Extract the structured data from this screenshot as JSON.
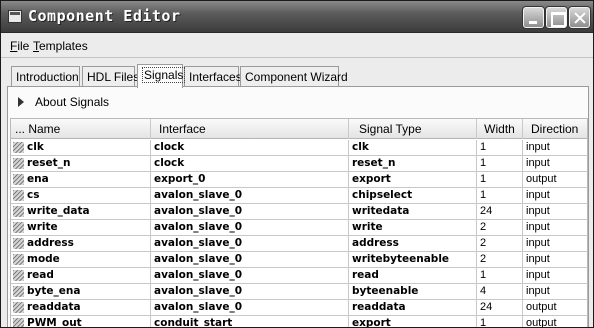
{
  "window": {
    "title": "Component Editor"
  },
  "menu": {
    "file": {
      "mnemonic": "F",
      "rest": "ile"
    },
    "templates": {
      "mnemonic": "T",
      "rest": "emplates"
    }
  },
  "tabs": [
    {
      "label": "Introduction",
      "active": false
    },
    {
      "label": "HDL Files",
      "active": false
    },
    {
      "label": "Signals",
      "active": true
    },
    {
      "label": "Interfaces",
      "active": false
    },
    {
      "label": "Component Wizard",
      "active": false
    }
  ],
  "about_section": {
    "label": "About Signals"
  },
  "table": {
    "columns": [
      "Name",
      "Interface",
      "Signal Type",
      "Width",
      "Direction"
    ],
    "rows": [
      {
        "name": "clk",
        "interface": "clock",
        "signal_type": "clk",
        "width": "1",
        "direction": "input"
      },
      {
        "name": "reset_n",
        "interface": "clock",
        "signal_type": "reset_n",
        "width": "1",
        "direction": "input"
      },
      {
        "name": "ena",
        "interface": "export_0",
        "signal_type": "export",
        "width": "1",
        "direction": "output"
      },
      {
        "name": "cs",
        "interface": "avalon_slave_0",
        "signal_type": "chipselect",
        "width": "1",
        "direction": "input"
      },
      {
        "name": "write_data",
        "interface": "avalon_slave_0",
        "signal_type": "writedata",
        "width": "24",
        "direction": "input"
      },
      {
        "name": "write",
        "interface": "avalon_slave_0",
        "signal_type": "write",
        "width": "2",
        "direction": "input"
      },
      {
        "name": "address",
        "interface": "avalon_slave_0",
        "signal_type": "address",
        "width": "2",
        "direction": "input"
      },
      {
        "name": "mode",
        "interface": "avalon_slave_0",
        "signal_type": "writebyteenable",
        "width": "2",
        "direction": "input"
      },
      {
        "name": "read",
        "interface": "avalon_slave_0",
        "signal_type": "read",
        "width": "1",
        "direction": "input"
      },
      {
        "name": "byte_ena",
        "interface": "avalon_slave_0",
        "signal_type": "byteenable",
        "width": "4",
        "direction": "input"
      },
      {
        "name": "readdata",
        "interface": "avalon_slave_0",
        "signal_type": "readdata",
        "width": "24",
        "direction": "output"
      },
      {
        "name": "PWM_out",
        "interface": "conduit_start",
        "signal_type": "export",
        "width": "1",
        "direction": "output"
      }
    ]
  }
}
